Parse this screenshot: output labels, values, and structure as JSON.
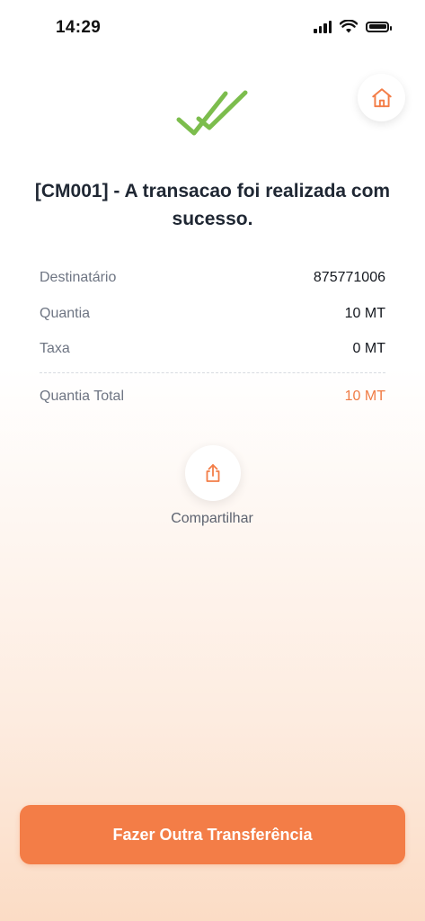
{
  "status_bar": {
    "time": "14:29",
    "battery_level": 1.0
  },
  "header": {
    "home_icon": "home-icon",
    "success_icon": "double-check-icon",
    "success_color": "#7cbd4d"
  },
  "result": {
    "title": "[CM001] - A transacao foi realizada com sucesso."
  },
  "details": [
    {
      "label": "Destinatário",
      "value": "875771006"
    },
    {
      "label": "Quantia",
      "value": "10 MT"
    },
    {
      "label": "Taxa",
      "value": "0 MT"
    }
  ],
  "total": {
    "label": "Quantia Total",
    "value": "10 MT"
  },
  "share": {
    "icon": "share-icon",
    "label": "Compartilhar"
  },
  "actions": {
    "primary_label": "Fazer Outra Transferência"
  },
  "colors": {
    "accent": "#f37d47",
    "success": "#7cbd4d",
    "text": "#1f2733",
    "muted": "#6e7583"
  }
}
